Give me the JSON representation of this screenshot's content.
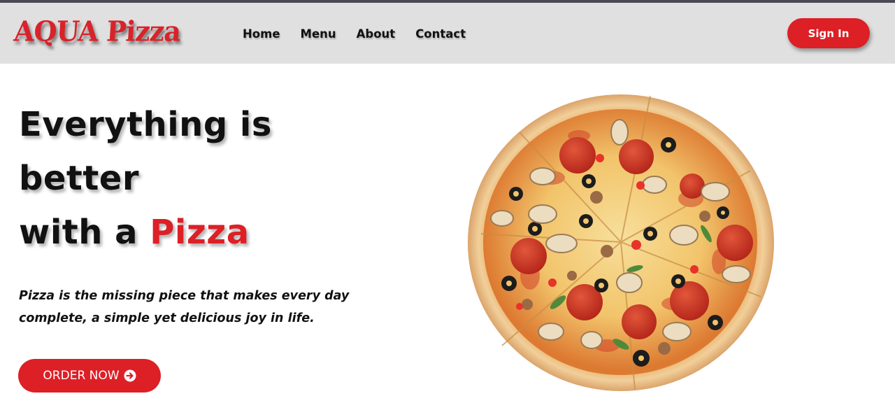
{
  "brand": {
    "logo_text": "AQUA Pizza"
  },
  "nav": {
    "items": [
      {
        "label": "Home"
      },
      {
        "label": "Menu"
      },
      {
        "label": "About"
      },
      {
        "label": "Contact"
      }
    ],
    "signin_label": "Sign In"
  },
  "hero": {
    "headline_line1": "Everything is",
    "headline_line2": "better",
    "headline_line3_prefix": "with a ",
    "headline_accent": "Pizza",
    "tagline": "Pizza is the missing piece that makes every day complete, a simple yet delicious joy in life.",
    "cta_label": "ORDER NOW",
    "cta_icon": "arrow-circle-right-icon",
    "image": "pizza-image"
  },
  "colors": {
    "accent": "#dd1f26",
    "navbar_bg": "#e0e0e0",
    "topline": "#4a4a55"
  }
}
